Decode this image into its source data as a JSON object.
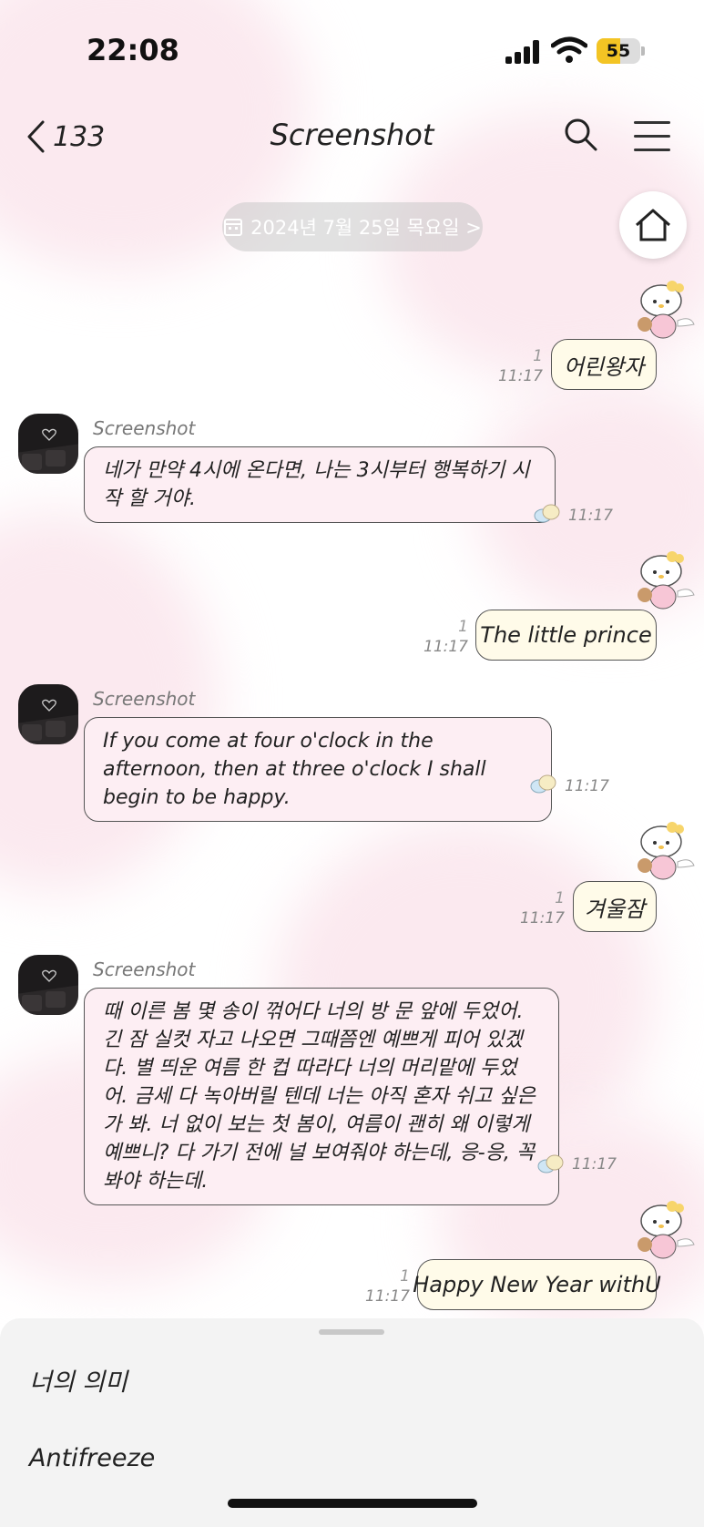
{
  "status": {
    "time": "22:08",
    "battery": "55",
    "battery_level": 0.55
  },
  "header": {
    "back_count": "133",
    "title": "Screenshot"
  },
  "date_pill": {
    "label": "2024년 7월 25일 목요일 >"
  },
  "messages": [
    {
      "dir": "out",
      "read": "1",
      "time": "11:17",
      "text": "어린왕자"
    },
    {
      "dir": "in",
      "sender": "Screenshot",
      "time": "11:17",
      "text": "네가 만약 4시에 온다면, 나는 3시부터 행복하기 시작 할 거야."
    },
    {
      "dir": "out",
      "read": "1",
      "time": "11:17",
      "text": "The little prince"
    },
    {
      "dir": "in",
      "sender": "Screenshot",
      "time": "11:17",
      "text": "If you come at four o'clock in the afternoon, then at three o'clock I shall begin to be happy."
    },
    {
      "dir": "out",
      "read": "1",
      "time": "11:17",
      "text": "겨울잠"
    },
    {
      "dir": "in",
      "sender": "Screenshot",
      "time": "11:17",
      "text": "때 이른 봄 몇 송이 꺾어다 너의 방 문 앞에 두었어. 긴 잠 실컷 자고 나오면 그때쯤엔 예쁘게 피어 있겠다. 별 띄운 여름 한 컵 따라다 너의 머리맡에 두었어. 금세 다 녹아버릴 텐데 너는 아직 혼자 쉬고 싶은가 봐. 너 없이 보는 첫 봄이, 여름이 괜히 왜 이렇게 예쁘니? 다 가기 전에 널 보여줘야 하는데, 응-응, 꼭 봐야 하는데."
    },
    {
      "dir": "out",
      "read": "1",
      "time": "11:17",
      "text": "Happy New Year withU"
    }
  ],
  "sheet": {
    "items": [
      "너의 의미",
      "Antifreeze"
    ]
  }
}
